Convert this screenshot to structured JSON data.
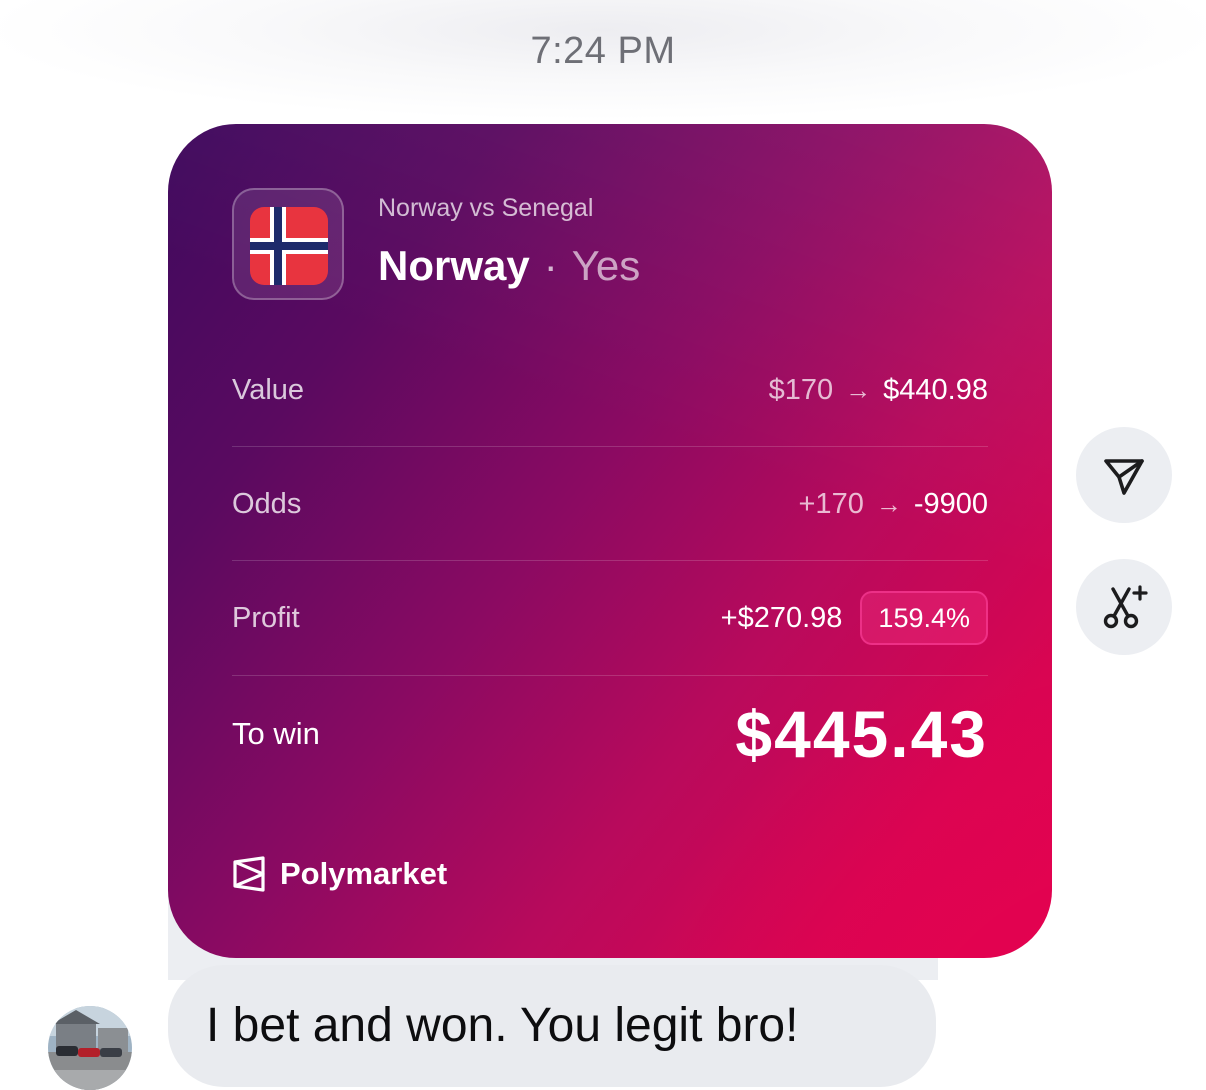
{
  "timestamp": "7:24 PM",
  "bet_card": {
    "match": "Norway vs Senegal",
    "pick": {
      "team": "Norway",
      "separator": "·",
      "outcome": "Yes"
    },
    "flag_icon": "norway-flag-icon",
    "rows": {
      "value": {
        "label": "Value",
        "from": "$170",
        "arrow": "→",
        "to": "$440.98"
      },
      "odds": {
        "label": "Odds",
        "from": "+170",
        "arrow": "→",
        "to": "-9900"
      },
      "profit": {
        "label": "Profit",
        "amount": "+$270.98",
        "percent": "159.4%"
      }
    },
    "to_win": {
      "label": "To win",
      "amount": "$445.43"
    },
    "brand": {
      "name": "Polymarket",
      "icon": "polymarket-logo-icon"
    },
    "colors": {
      "gradient_start": "#3f0a5e",
      "gradient_end": "#e00550"
    }
  },
  "side_actions": {
    "share_icon": "send-icon",
    "remix_icon": "scissors-sparkle-icon"
  },
  "message": {
    "text": "I bet and won. You legit bro!"
  },
  "avatar": {
    "icon": "avatar"
  }
}
